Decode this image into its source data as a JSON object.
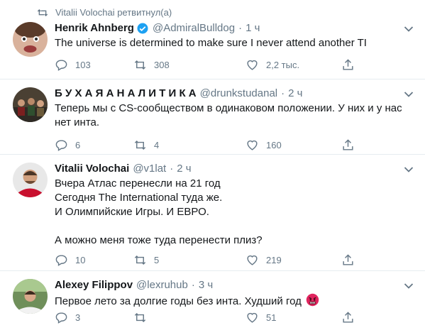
{
  "retweet_notice": "Vitalii Volochai ретвитнул(а)",
  "tweets": [
    {
      "name": "Henrik Ahnberg",
      "verified": true,
      "handle": "@AdmiralBulldog",
      "dot": "·",
      "time": "1 ч",
      "text": "The universe is determined to make sure I never attend another TI",
      "replies": "103",
      "retweets": "308",
      "likes": "2,2 тыс."
    },
    {
      "name": "Б У Х А Я А Н А Л И Т И К А",
      "verified": false,
      "handle": "@drunkstudanal",
      "dot": "·",
      "time": "2 ч",
      "text": "Теперь мы с CS-сообществом в одинаковом положении. У них и у нас нет инта.",
      "replies": "6",
      "retweets": "4",
      "likes": "160"
    },
    {
      "name": "Vitalii Volochai",
      "verified": false,
      "handle": "@v1lat",
      "dot": "·",
      "time": "2 ч",
      "text": "Вчера Атлас перенесли на 21 год\nСегодня The International туда же.\nИ Олимпийские Игры. И ЕВРО.\n\nА можно меня тоже туда перенести плиз?",
      "replies": "10",
      "retweets": "5",
      "likes": "219"
    },
    {
      "name": "Alexey Filippov",
      "verified": false,
      "handle": "@lexruhub",
      "dot": "·",
      "time": "3 ч",
      "text": "Первое лето за долгие годы без инта. Худший год",
      "emoji": "angry-face",
      "replies": "3",
      "retweets": "",
      "likes": "51"
    }
  ],
  "colors": {
    "text": "#14171a",
    "secondary": "#657786",
    "verified": "#1da1f2",
    "divider": "#e6ecf0"
  }
}
